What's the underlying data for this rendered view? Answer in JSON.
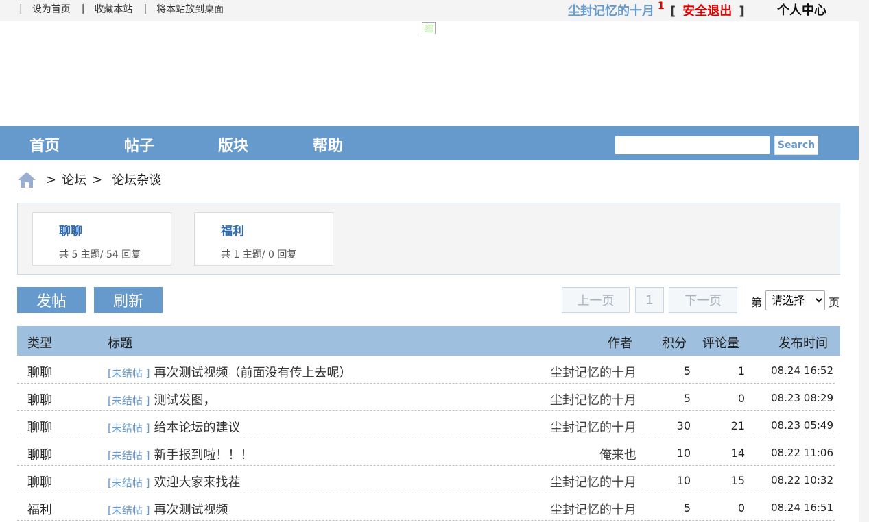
{
  "topbar": {
    "links": [
      "设为首页",
      "收藏本站",
      "将本站放到桌面"
    ],
    "separator": "|",
    "username": "尘封记忆的十月",
    "message_count": "1",
    "logout_open": "[",
    "logout_label": "安全退出",
    "logout_close": "]",
    "user_center": "个人中心"
  },
  "nav": {
    "items": [
      "首页",
      "帖子",
      "版块",
      "帮助"
    ],
    "search_value": "",
    "search_button": "Search"
  },
  "breadcrumb": {
    "sep": ">",
    "forum": "论坛",
    "current": "论坛杂谈"
  },
  "boards": [
    {
      "name": "聊聊",
      "stats": "共 5 主题/ 54 回复"
    },
    {
      "name": "福利",
      "stats": "共 1 主题/ 0 回复"
    }
  ],
  "actions": {
    "post": "发帖",
    "refresh": "刷新"
  },
  "pager": {
    "prev": "上一页",
    "current_page": "1",
    "next": "下一页",
    "prefix": "第",
    "select_value": "请选择",
    "suffix": "页"
  },
  "table": {
    "headers": {
      "type": "类型",
      "title": "标题",
      "author": "作者",
      "score": "积分",
      "comments": "评论量",
      "time": "发布时间"
    },
    "rows": [
      {
        "type": "聊聊",
        "tag": "[未结帖 ]",
        "title": "再次测试视频（前面没有传上去呢）",
        "author": "尘封记忆的十月",
        "score": "5",
        "comments": "1",
        "time": "08.24 16:52"
      },
      {
        "type": "聊聊",
        "tag": "[未结帖 ]",
        "title": "测试发图，",
        "author": "尘封记忆的十月",
        "score": "5",
        "comments": "0",
        "time": "08.23 08:29"
      },
      {
        "type": "聊聊",
        "tag": "[未结帖 ]",
        "title": "给本论坛的建议",
        "author": "尘封记忆的十月",
        "score": "30",
        "comments": "21",
        "time": "08.23 05:49"
      },
      {
        "type": "聊聊",
        "tag": "[未结帖 ]",
        "title": "新手报到啦！！！",
        "author": "俺来也",
        "score": "10",
        "comments": "14",
        "time": "08.22 11:06"
      },
      {
        "type": "聊聊",
        "tag": "[未结帖 ]",
        "title": "欢迎大家来找茬",
        "author": "尘封记忆的十月",
        "score": "10",
        "comments": "15",
        "time": "08.22 10:32"
      },
      {
        "type": "福利",
        "tag": "[未结帖 ]",
        "title": "再次测试视频",
        "author": "尘封记忆的十月",
        "score": "5",
        "comments": "0",
        "time": "08.24 16:51"
      }
    ]
  },
  "colors": {
    "nav_bg": "#6699cc",
    "table_header_bg": "#9fbfdf",
    "logout_red": "#e00000",
    "link_blue": "#2e6db4"
  }
}
